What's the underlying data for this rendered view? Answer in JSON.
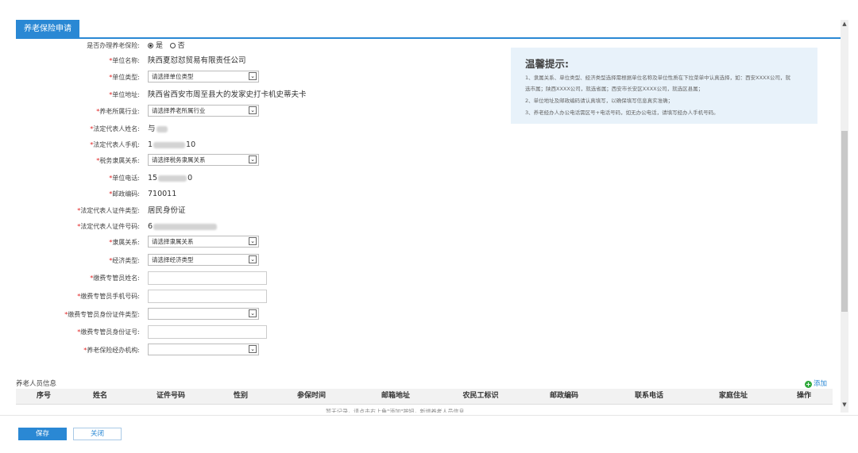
{
  "tab": {
    "title": "养老保险申请"
  },
  "form": {
    "apply_label": "是否办理养老保险:",
    "apply_yes": "是",
    "apply_no": "否",
    "unit_name_label": "单位名称:",
    "unit_name_value": "陕西夏怼怼贸易有限责任公司",
    "unit_type_label": "单位类型:",
    "unit_type_value": "请选择单位类型",
    "unit_address_label": "单位地址:",
    "unit_address_value": "陕西省西安市周至县大的发家史打卡机史蒂夫卡",
    "industry_label": "养老所属行业:",
    "industry_value": "请选择养老所属行业",
    "legal_name_label": "法定代表人姓名:",
    "legal_name_prefix": "与",
    "legal_phone_label": "法定代表人手机:",
    "legal_phone_prefix": "1",
    "legal_phone_suffix": "10",
    "tax_label": "税务隶属关系:",
    "tax_value": "请选择税务隶属关系",
    "unit_phone_label": "单位电话:",
    "unit_phone_prefix": "15",
    "unit_phone_suffix": "0",
    "postcode_label": "邮政编码:",
    "postcode_value": "710011",
    "id_type_label": "法定代表人证件类型:",
    "id_type_value": "居民身份证",
    "id_no_label": "法定代表人证件号码:",
    "id_no_prefix": "6",
    "affiliation_label": "隶属关系:",
    "affiliation_value": "请选择隶属关系",
    "economy_label": "经济类型:",
    "economy_value": "请选择经济类型",
    "manager_name_label": "缴费专管员姓名:",
    "manager_phone_label": "缴费专管员手机号码:",
    "manager_id_type_label": "缴费专管员身份证件类型:",
    "manager_id_no_label": "缴费专管员身份证号:",
    "agency_label": "养老保险经办机构:"
  },
  "tips": {
    "title": "温馨提示:",
    "lines": [
      "1、隶属关系、单位类型、经济类型选择需根据单位名称及单位性质在下拉菜单中认真选择，如：西安XXXX公司，就",
      "选市属；陕西XXXX公司，就选省属；西安市长安区XXXX公司，就选区县属；",
      "2、单位地址及邮政编码请认真填写，以确保填写信息真实准确；",
      "3、养老经办人办公电话需区号+电话号码，如无办公电话，请填写经办人手机号码。"
    ]
  },
  "staff": {
    "section_title": "养老人员信息",
    "add_label": "添加",
    "columns": [
      "序号",
      "姓名",
      "证件号码",
      "性别",
      "参保时间",
      "邮箱地址",
      "农民工标识",
      "邮政编码",
      "联系电话",
      "家庭住址",
      "操作"
    ],
    "empty_text": "暂无记录，请点击右上角\"添加\"按钮，新增养老人员信息"
  },
  "actions": {
    "save_label": "保存",
    "close_label": "关闭"
  }
}
